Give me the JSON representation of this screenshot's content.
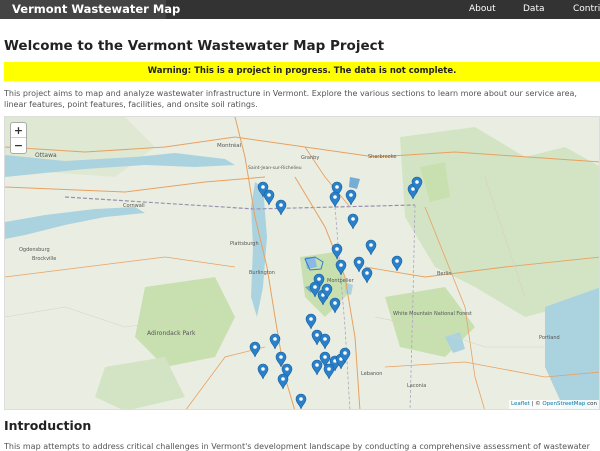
{
  "navbar": {
    "brand": "Vermont Wastewater Map",
    "links": [
      "About",
      "Data",
      "Contri"
    ]
  },
  "page": {
    "title": "Welcome to the Vermont Wastewater Map Project",
    "warning": "Warning: This is a project in progress. The data is not complete.",
    "intro": "This project aims to map and analyze wastewater infrastructure in Vermont. Explore the various sections to learn more about our service area, linear features, point features, facilities, and onsite soil ratings."
  },
  "map": {
    "zoom_in": "+",
    "zoom_out": "−",
    "attribution_leaflet": "Leaflet",
    "attribution_sep": " | © ",
    "attribution_osm": "OpenStreetMap",
    "attribution_tail": " con",
    "place_labels": [
      "Ottawa",
      "Montréal",
      "Saint-Jean-sur-Richelieu",
      "Granby",
      "Sherbrooke",
      "Cornwall",
      "Ogdensburg",
      "Brockville",
      "Plattsburgh",
      "Burlington",
      "Montpelier",
      "Berlin",
      "Adirondack Park",
      "White Mountain National Forest",
      "Laconia",
      "Portland",
      "Lebanon"
    ],
    "marker_icon": "map-pin-icon"
  },
  "colors": {
    "navbar": "#333333",
    "warning_bg": "#ffff00",
    "marker": "#2a81cb",
    "water": "#aad3df",
    "forest": "#c8e0b0"
  },
  "intro_section": {
    "title": "Introduction",
    "text": "This map attempts to address critical challenges in Vermont's development landscape by conducting a comprehensive assessment of wastewater"
  }
}
